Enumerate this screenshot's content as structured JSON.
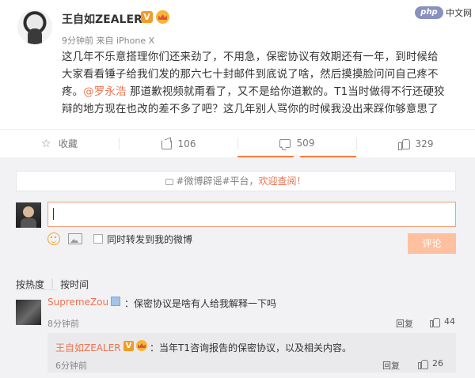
{
  "post": {
    "author": "王自如ZEALER",
    "v_badge": "V",
    "time": "9分钟前",
    "source": "来自 iPhone X",
    "text_part1": "这几年不乐意搭理你们还来劲了，不用急，保密协议有效期还有一年，到时候给\n大家看看锤子给我们发的那六七十封邮件到底说了啥，然后摸摸脸问问自己疼不\n疼。",
    "mention": "@罗永浩",
    "text_part2": " 那道歉视频就甭看了，又不是给你道歉的。T1当时做得不行还硬狡\n辩的地方现在也改的差不多了吧？这几年别人骂你的时候我没出来踩你够意思了"
  },
  "actions": {
    "favorite_label": "收藏",
    "repost_count": "106",
    "comment_count": "509",
    "like_count": "329"
  },
  "comments": {
    "notice_prefix": "#微博辟谣#平台，",
    "notice_highlight": "欢迎查阅！",
    "input_value": "",
    "sync_label": "同时转发到我的微博",
    "submit_label": "评论",
    "sort_hot": "按热度",
    "sort_time": "按时间",
    "items": [
      {
        "user": "SupremeZou",
        "text": "：保密协议是啥有人给我解释一下吗",
        "time": "8分钟前",
        "reply_label": "回复",
        "likes": "44"
      },
      {
        "user": "王自如ZEALER",
        "v_badge": "V",
        "text": "：当年T1咨询报告的保密协议，以及相关内容。",
        "time": "6分钟前",
        "reply_label": "回复",
        "likes": "26"
      }
    ]
  },
  "watermark": {
    "logo": "php",
    "text": "中文网"
  },
  "colors": {
    "accent": "#eb7350",
    "submit_disabled": "#ffc09f",
    "comments_bg": "#f2f2f5"
  }
}
